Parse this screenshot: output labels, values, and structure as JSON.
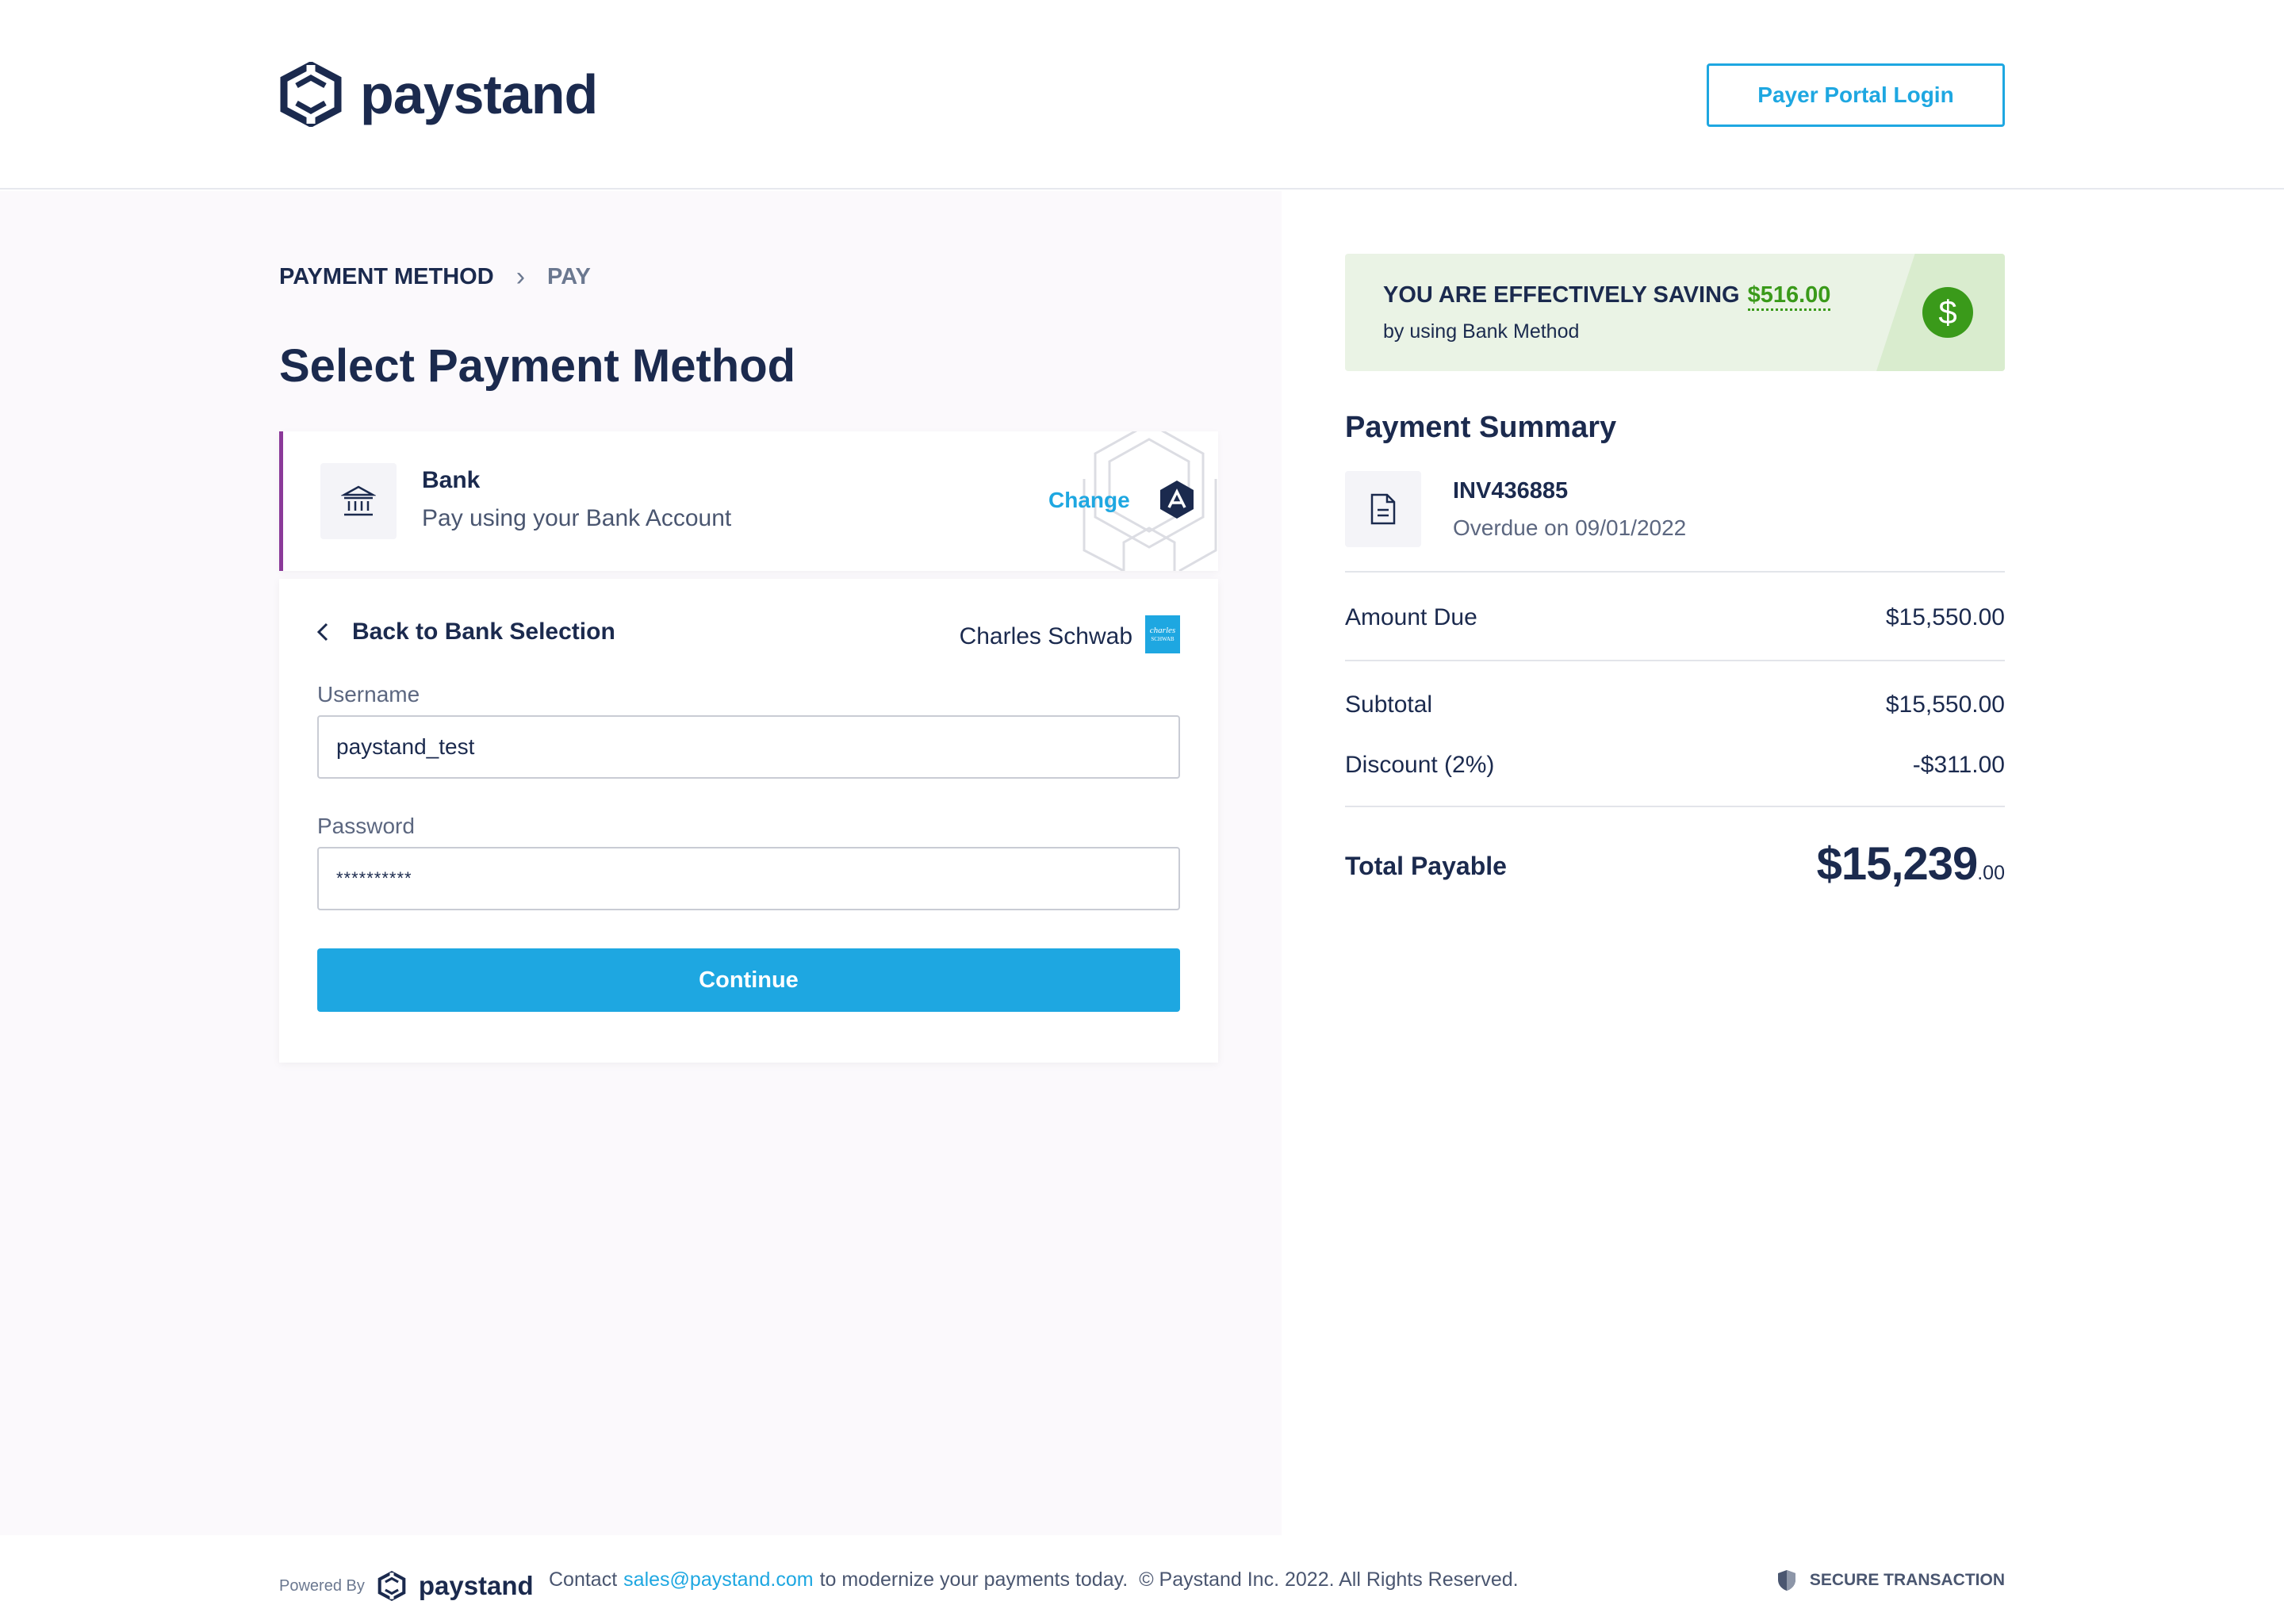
{
  "header": {
    "brand": "paystand",
    "portal_button": "Payer Portal Login"
  },
  "breadcrumb": {
    "step1": "PAYMENT METHOD",
    "separator": "›",
    "step2": "PAY"
  },
  "page_title": "Select Payment Method",
  "method": {
    "title": "Bank",
    "subtitle": "Pay using your Bank Account",
    "change": "Change"
  },
  "bank_form": {
    "back_label": "Back to Bank Selection",
    "bank_name": "Charles Schwab",
    "bank_logo_line1": "charles",
    "bank_logo_line2": "SCHWAB",
    "username_label": "Username",
    "username_value": "paystand_test",
    "password_label": "Password",
    "password_value": "**********",
    "continue": "Continue"
  },
  "saving": {
    "prefix": "YOU ARE EFFECTIVELY SAVING",
    "amount": "$516.00",
    "sub": "by using Bank Method",
    "icon": "$"
  },
  "summary": {
    "title": "Payment Summary",
    "invoice": "INV436885",
    "due": "Overdue on 09/01/2022",
    "rows": [
      {
        "label": "Amount Due",
        "value": "$15,550.00"
      },
      {
        "label": "Subtotal",
        "value": "$15,550.00"
      },
      {
        "label": "Discount (2%)",
        "value": "-$311.00"
      }
    ],
    "total_label": "Total Payable",
    "total_main": "$15,239",
    "total_cents": ".00"
  },
  "footer": {
    "powered_by": "Powered By",
    "brand": "paystand",
    "contact_prefix": "Contact",
    "email": "sales@paystand.com",
    "contact_suffix": "to modernize your payments today.",
    "copyright": "© Paystand Inc. 2022. All Rights Reserved.",
    "secure": "SECURE TRANSACTION"
  },
  "colors": {
    "accent": "#1ea7e1",
    "navy": "#1b2a4e",
    "method_border": "#8b3a99",
    "saving_green": "#3a9a1a"
  }
}
